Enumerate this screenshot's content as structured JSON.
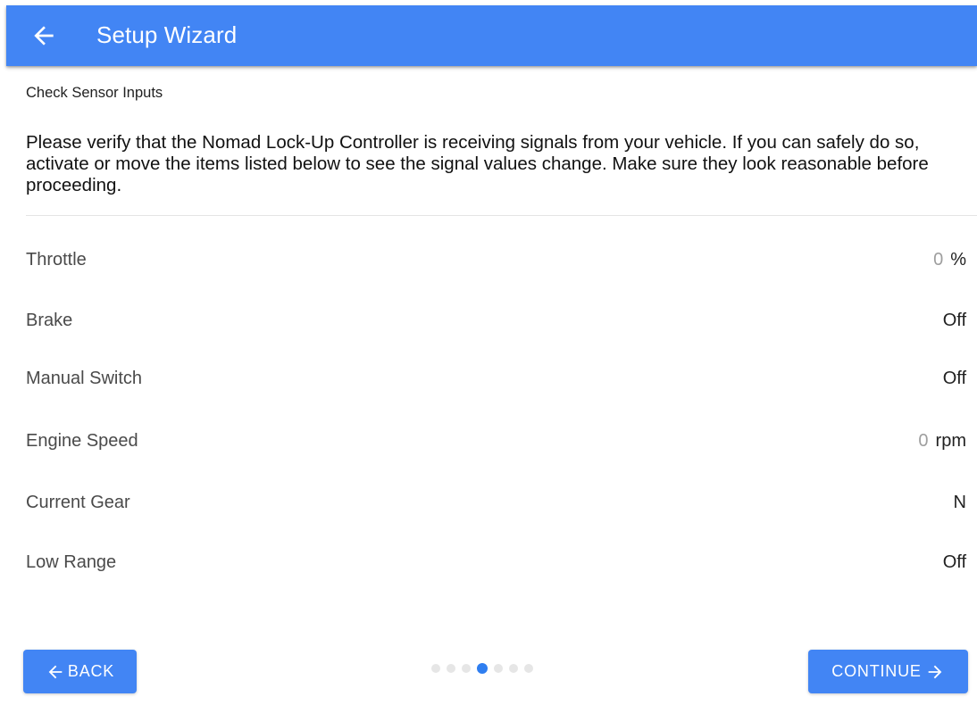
{
  "header": {
    "title": "Setup Wizard",
    "back_icon": "arrow-left-icon",
    "background_color": "#4285f4"
  },
  "step": {
    "title": "Check Sensor Inputs",
    "description": "Please verify that the Nomad Lock-Up Controller is receiving signals from your vehicle. If you can safely do so, activate or move the items listed below to see the signal values change. Make sure they look reasonable before proceeding."
  },
  "sensors": [
    {
      "label": "Throttle",
      "value": "0",
      "unit": "%"
    },
    {
      "label": "Brake",
      "value": "Off",
      "unit": ""
    },
    {
      "label": "Manual Switch",
      "value": "Off",
      "unit": ""
    },
    {
      "label": "Engine Speed",
      "value": "0",
      "unit": "rpm"
    },
    {
      "label": "Current Gear",
      "value": "N",
      "unit": ""
    },
    {
      "label": "Low Range",
      "value": "Off",
      "unit": ""
    }
  ],
  "footer": {
    "back_label": "BACK",
    "continue_label": "CONTINUE",
    "back_icon": "arrow-left-icon",
    "continue_icon": "arrow-right-icon",
    "progress": {
      "total_steps": 7,
      "current_step": 4
    },
    "accent_color": "#2f7ef0"
  }
}
